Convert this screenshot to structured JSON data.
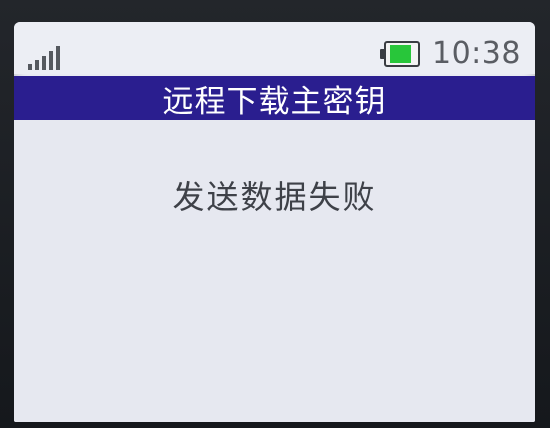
{
  "status": {
    "time": "10:38",
    "signal_icon": "signal-strength-icon",
    "battery_icon": "battery-icon",
    "battery_level_percent": 80,
    "battery_color": "#28c63a"
  },
  "title": "远程下载主密钥",
  "message": "发送数据失败",
  "colors": {
    "title_bar": "#2a1e8f",
    "screen_bg": "#e9ebf2",
    "text": "#3e4148"
  }
}
